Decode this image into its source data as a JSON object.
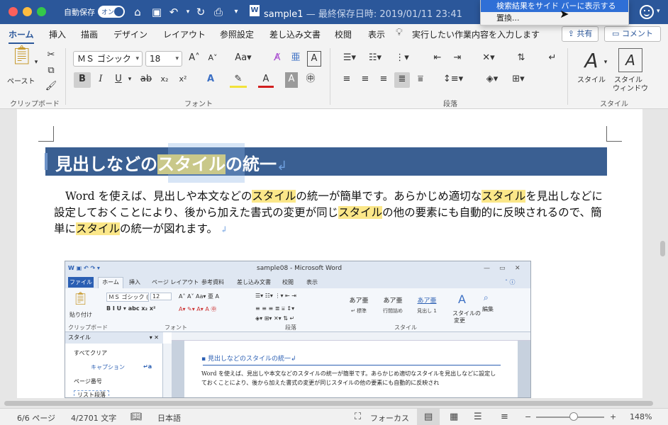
{
  "titlebar": {
    "autosave_label": "自動保存",
    "autosave_state": "オン",
    "doc_name": "sample1",
    "last_saved": "— 最終保存日時: 2019/01/11 23:41",
    "icons": [
      "home-icon",
      "save-icon",
      "undo-icon",
      "redo-icon",
      "print-icon",
      "customize-icon",
      "smiley-feedback-icon"
    ]
  },
  "menu": {
    "items": [
      {
        "label": "検索結果をサイド バーに表示する",
        "active": true
      },
      {
        "label": "置換...",
        "active": false
      }
    ]
  },
  "tabs": {
    "items": [
      "ホーム",
      "挿入",
      "描画",
      "デザイン",
      "レイアウト",
      "参照設定",
      "差し込み文書",
      "校閲",
      "表示"
    ],
    "active": "ホーム",
    "tell_me": "実行したい作業内容を入力します",
    "share": "共有",
    "comment": "コメント"
  },
  "ribbon": {
    "groups": {
      "clipboard": "クリップボード",
      "font": "フォント",
      "paragraph": "段落",
      "styles": "スタイル"
    },
    "paste_label": "ペースト",
    "font_name": "ＭＳ ゴシック",
    "font_size": "18",
    "styles_label": "スタイル",
    "styles_pane_label_1": "スタイル",
    "styles_pane_label_2": "ウィンドウ",
    "font_buttons": {
      "bold": "B",
      "italic": "I",
      "underline": "U",
      "strike": "ab",
      "sub": "x₂",
      "sup": "x²",
      "grow": "A",
      "shrink": "A",
      "case": "Aa"
    }
  },
  "document": {
    "heading": {
      "before": "見出しなどの",
      "highlight": "スタイル",
      "after": "の統一"
    },
    "paragraph": [
      {
        "text": "Word を使えば、見出しや本文などの",
        "hl": false
      },
      {
        "text": "スタイル",
        "hl": true
      },
      {
        "text": "の統一が簡単です。あらかじめ適切な",
        "hl": false
      },
      {
        "text": "スタイル",
        "hl": true
      },
      {
        "text": "を見出しなどに設定しておくことにより、後から加えた書式の変更が同じ",
        "hl": false
      },
      {
        "text": "スタイル",
        "hl": true
      },
      {
        "text": "の他の要素にも自動的に反映されるので、簡単に",
        "hl": false
      },
      {
        "text": "スタイル",
        "hl": true
      },
      {
        "text": "の統一が図れます。",
        "hl": false
      }
    ]
  },
  "embedded": {
    "title": "sample08 - Microsoft Word",
    "file_tab": "ファイル",
    "home_tab": "ホーム",
    "tabs": [
      "挿入",
      "ページ レイアウト",
      "参考資料",
      "差し込み文書",
      "校閲",
      "表示"
    ],
    "font_name": "ＭＳ ゴシック (",
    "font_size": "12",
    "paste": "貼り付け",
    "groups": [
      "クリップボード",
      "フォント",
      "段落",
      "スタイル"
    ],
    "styles": [
      {
        "sample": "あア亜",
        "name": "↵ 標準"
      },
      {
        "sample": "あア亜",
        "name": "行間詰め"
      },
      {
        "sample": "あア亜",
        "name": "見出し 1"
      }
    ],
    "style_change": "スタイルの",
    "style_change_2": "変更",
    "edit": "編集",
    "pane_title": "スタイル",
    "pane_items": [
      "すべてクリア",
      "キャプション",
      "ページ番号",
      "リスト段落"
    ],
    "heading": "見出しなどのスタイルの統一",
    "body": "Word を使えば、見出しや本文などのスタイルの統一が簡単です。あらかじめ適切なスタイルを見出しなどに設定しておくことにより、後から加えた書式の変更が同じスタイルの他の要素にも自動的に反映され"
  },
  "status": {
    "page": "6/6 ページ",
    "words": "4/2701 文字",
    "language": "日本語",
    "focus": "フォーカス",
    "zoom": "148%",
    "zoom_minus": "−",
    "zoom_plus": "+"
  },
  "colors": {
    "titlebar": "#2b579a",
    "heading_bg": "#3a5f92",
    "find_highlight": "#fbe789",
    "menu_active": "#2f6fd6"
  }
}
